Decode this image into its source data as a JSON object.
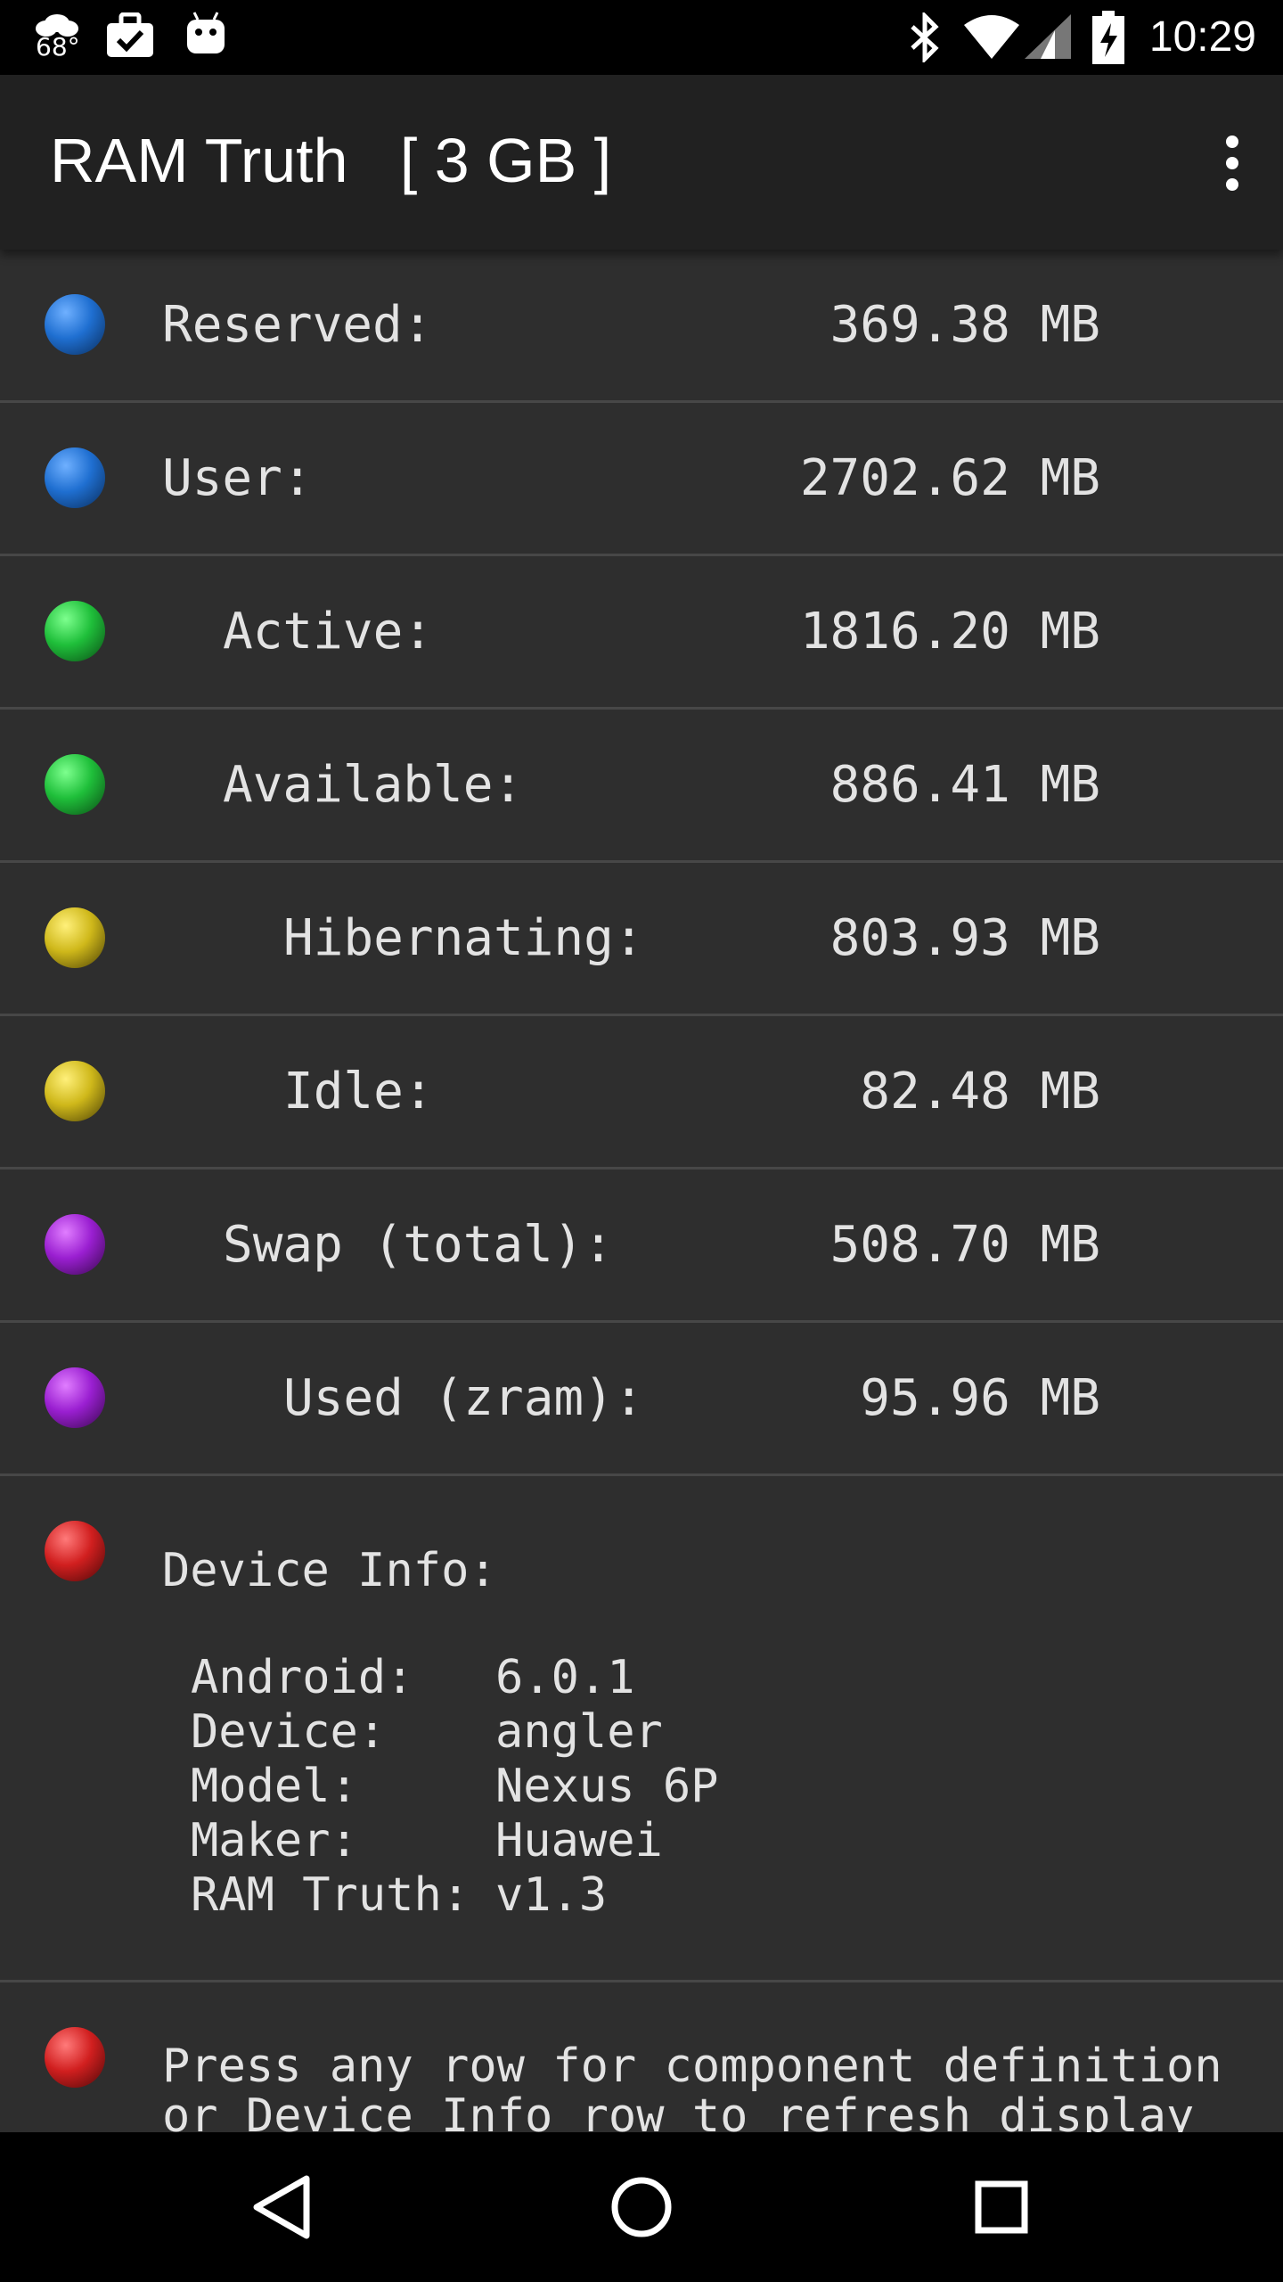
{
  "status_bar": {
    "temperature": "68°",
    "time": "10:29",
    "icons": [
      "weather-icon",
      "briefcase-check-icon",
      "android-icon",
      "bluetooth-icon",
      "wifi-icon",
      "cell-signal-icon",
      "battery-charging-icon"
    ]
  },
  "app_bar": {
    "title": "RAM Truth   [ 3 GB ]",
    "menu_icon": "more-vert-icon"
  },
  "rows": [
    {
      "label": "Reserved:",
      "value": "369.38 MB",
      "indent": 0,
      "color": "#1f6fd1"
    },
    {
      "label": "User:",
      "value": "2702.62 MB",
      "indent": 0,
      "color": "#1f6fd1"
    },
    {
      "label": "Active:",
      "value": "1816.20 MB",
      "indent": 1,
      "color": "#1fbf3a"
    },
    {
      "label": "Available:",
      "value": "886.41 MB",
      "indent": 1,
      "color": "#1fbf3a"
    },
    {
      "label": "Hibernating:",
      "value": "803.93 MB",
      "indent": 2,
      "color": "#cfb81a"
    },
    {
      "label": "Idle:",
      "value": "82.48 MB",
      "indent": 2,
      "color": "#cfb81a"
    },
    {
      "label": "Swap (total):",
      "value": "508.70 MB",
      "indent": 1,
      "color": "#9a1fd1"
    },
    {
      "label": "Used (zram):",
      "value": "95.96 MB",
      "indent": 2,
      "color": "#9a1fd1"
    }
  ],
  "device_info": {
    "title": "Device Info:",
    "color": "#d11f1f",
    "items": [
      {
        "key": "Android:",
        "value": "6.0.1"
      },
      {
        "key": "Device:",
        "value": "angler"
      },
      {
        "key": "Model:",
        "value": "Nexus 6P"
      },
      {
        "key": "Maker:",
        "value": "Huawei"
      },
      {
        "key": "RAM Truth:",
        "value": "v1.3"
      }
    ]
  },
  "help_row": {
    "color": "#d11f1f",
    "line1": "Press any row for component definition",
    "line2": "or Device Info row to refresh display"
  },
  "nav_bar": {
    "icons": [
      "back-icon",
      "home-icon",
      "recents-icon"
    ]
  }
}
